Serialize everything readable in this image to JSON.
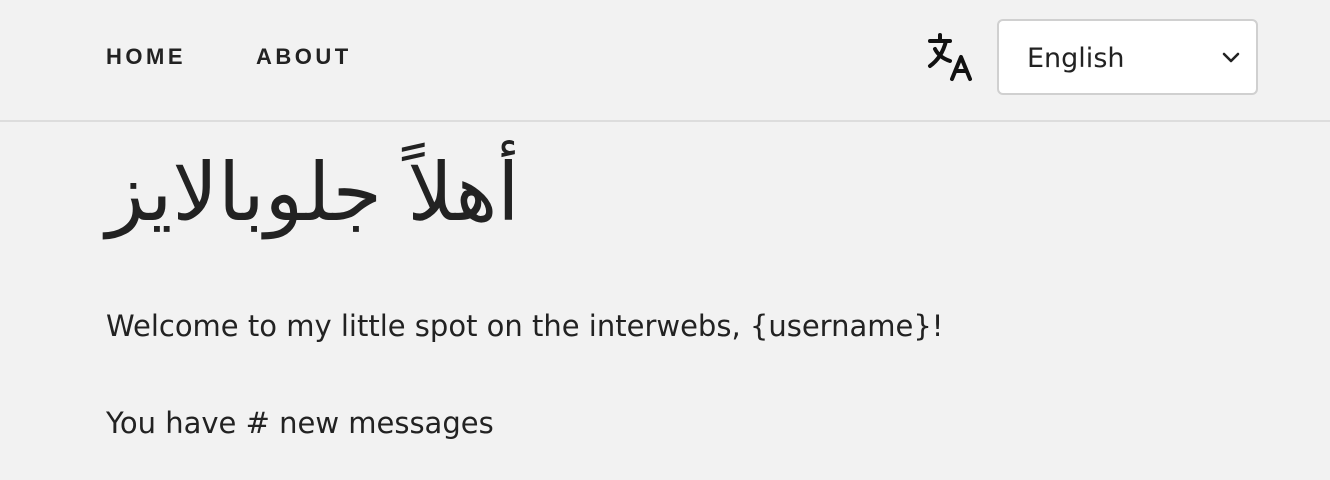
{
  "nav": {
    "items": [
      {
        "label": "HOME"
      },
      {
        "label": "ABOUT"
      }
    ]
  },
  "language": {
    "icon": "translate-icon",
    "selected": "English"
  },
  "main": {
    "greeting": "أهلاً جلوبالايز",
    "welcome": "Welcome to my little spot on the interwebs, {username}!",
    "messages": "You have # new messages"
  }
}
